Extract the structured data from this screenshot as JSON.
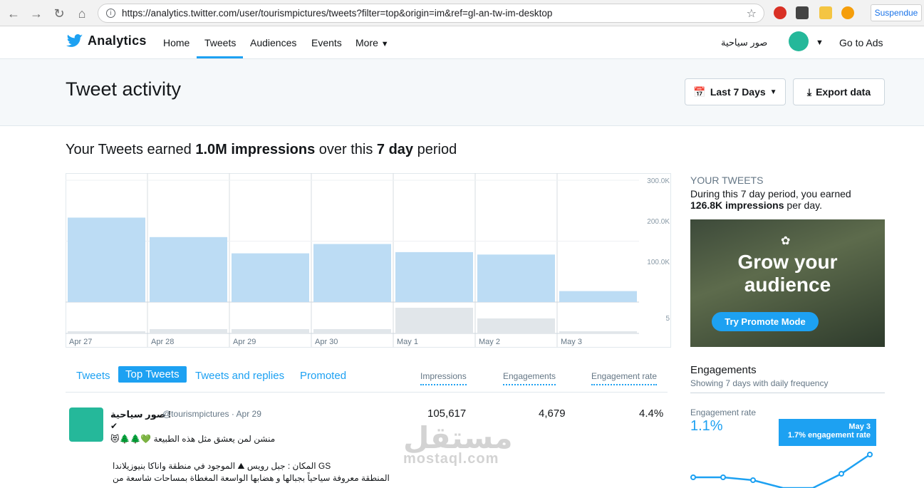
{
  "browser": {
    "url": "https://analytics.twitter.com/user/tourismpictures/tweets?filter=top&origin=im&ref=gl-an-tw-im-desktop",
    "profile_label": "Suspendue"
  },
  "header": {
    "brand": "Analytics",
    "nav": [
      "Home",
      "Tweets",
      "Audiences",
      "Events",
      "More"
    ],
    "user_name": "صور سياحية",
    "go_to_ads": "Go to Ads"
  },
  "subheader": {
    "title": "Tweet activity",
    "date_range": "Last 7 Days",
    "export": "Export data"
  },
  "summary": {
    "prefix": "Your Tweets earned ",
    "impressions": "1.0M impressions",
    "middle": " over this ",
    "period": "7 day",
    "suffix": " period"
  },
  "chart_data": {
    "type": "bar",
    "categories": [
      "Apr 27",
      "Apr 28",
      "Apr 29",
      "Apr 30",
      "May 1",
      "May 2",
      "May 3"
    ],
    "y_ticks": [
      "300.0K",
      "200.0K",
      "100.0K"
    ],
    "ylim": [
      0,
      300000
    ],
    "series": [
      {
        "values": [
          208000,
          160000,
          120000,
          143000,
          123000,
          117000,
          27000
        ]
      }
    ],
    "secondary": {
      "y_ticks": [
        "5"
      ],
      "ylim": [
        0,
        7
      ],
      "values": [
        0.5,
        1,
        1,
        1,
        6,
        3.5,
        0.5
      ]
    }
  },
  "side": {
    "your_tweets_label": "YOUR TWEETS",
    "your_tweets_text": "During this 7 day period, you earned",
    "impressions_per_day": "126.8K impressions",
    "per_day_suffix": " per day.",
    "promo_line1": "Grow your",
    "promo_line2": "audience",
    "promo_cta": "Try Promote Mode"
  },
  "tabs": [
    "Tweets",
    "Top Tweets",
    "Tweets and replies",
    "Promoted"
  ],
  "columns": [
    "Impressions",
    "Engagements",
    "Engagement rate"
  ],
  "tweet": {
    "name": "صور سياحية !",
    "handle": "@tourismpictures · Apr 29",
    "line1": "منشن لمن يعشق مثل هذه الطبيعة 💚🌲🌲😻",
    "line2": "GS المكان : جبل رويس ⛰ الموجود في منطقة واناكا بنيوزيلاندا",
    "line3": "المنطقة معروفة سياحياً بجبالها و هضابها الواسعة المغطاة بمساحات شاسعة من",
    "impressions": "105,617",
    "engagements": "4,679",
    "rate": "4.4%"
  },
  "engagements": {
    "title": "Engagements",
    "subtitle": "Showing 7 days with daily frequency",
    "rate_label": "Engagement rate",
    "rate_value": "1.1%",
    "tooltip_date": "May 3",
    "tooltip_value": "1.7% engagement rate"
  },
  "watermark": {
    "ar": "مستقل",
    "en": "mostaql.com"
  }
}
